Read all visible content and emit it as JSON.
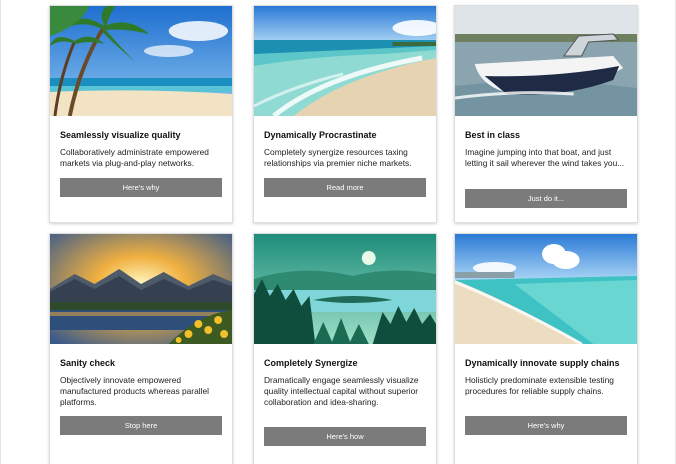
{
  "cards": [
    {
      "title": "Seamlessly visualize quality",
      "text": "Collaboratively administrate empowered markets via plug-and-play networks.",
      "button": "Here's why",
      "image": "tropical-beach-palms"
    },
    {
      "title": "Dynamically Procrastinate",
      "text": "Completely synergize resources taxing relationships via premier niche markets.",
      "button": "Read more",
      "image": "beach-waves"
    },
    {
      "title": "Best in class",
      "text": "Imagine jumping into that boat, and just letting it sail wherever the wind takes you...",
      "button": "Just do it...",
      "image": "speedboat"
    },
    {
      "title": "Sanity check",
      "text": "Objectively innovate empowered manufactured products whereas parallel platforms.",
      "button": "Stop here",
      "image": "mountain-sunset-lake"
    },
    {
      "title": "Completely Synergize",
      "text": "Dramatically engage seamlessly visualize quality intellectual capital without superior collaboration and idea-sharing.",
      "button": "Here's how",
      "image": "teal-forest-lake"
    },
    {
      "title": "Dynamically innovate supply chains",
      "text": "Holisticly predominate extensible testing procedures for reliable supply chains.",
      "button": "Here's why",
      "image": "turquoise-beach"
    }
  ]
}
